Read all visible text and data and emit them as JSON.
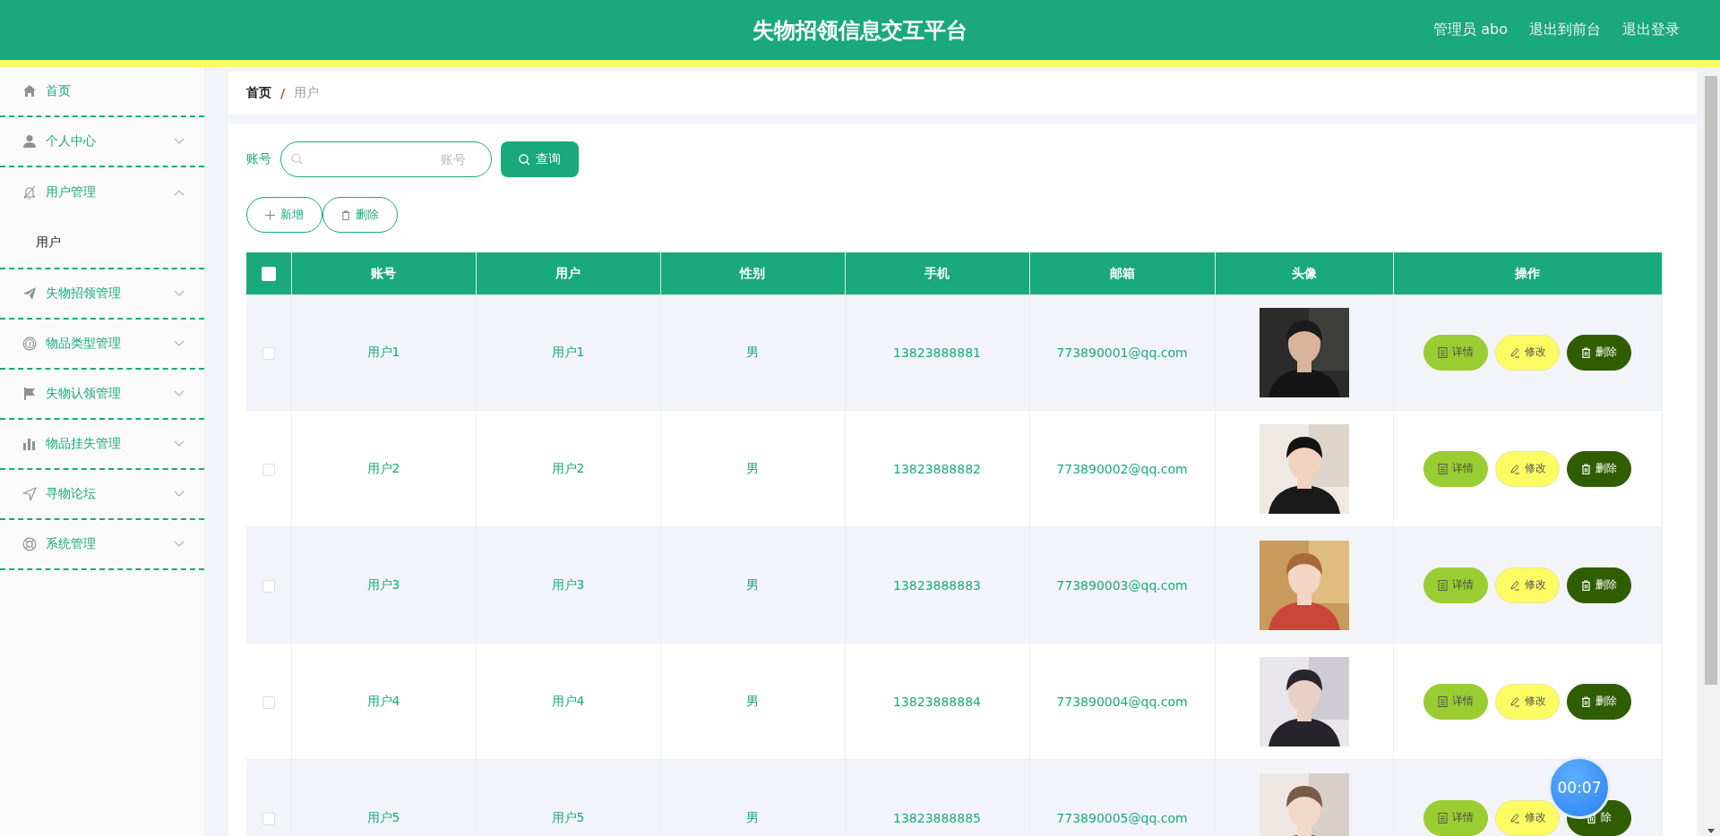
{
  "header": {
    "title": "失物招领信息交互平台",
    "links": [
      "管理员 abo",
      "退出到前台",
      "退出登录"
    ]
  },
  "sidebar": {
    "items": [
      {
        "label": "首页"
      },
      {
        "label": "个人中心",
        "expanded": false
      },
      {
        "label": "用户管理",
        "expanded": true,
        "children": [
          {
            "label": "用户"
          }
        ]
      },
      {
        "label": "失物招领管理",
        "expanded": false
      },
      {
        "label": "物品类型管理",
        "expanded": false
      },
      {
        "label": "失物认领管理",
        "expanded": false
      },
      {
        "label": "物品挂失管理",
        "expanded": false
      },
      {
        "label": "寻物论坛",
        "expanded": false
      },
      {
        "label": "系统管理",
        "expanded": false
      }
    ]
  },
  "breadcrumb": [
    "首页",
    "/",
    "用户"
  ],
  "search": {
    "label": "账号",
    "placeholder": "账号",
    "button": "查询"
  },
  "toolbar": [
    "新增",
    "删除"
  ],
  "table": {
    "all_checked": false,
    "columns": [
      "账号",
      "用户",
      "性别",
      "手机",
      "邮箱",
      "头像",
      "操作"
    ],
    "rows": [
      {
        "checked": false,
        "cells": [
          "用户1",
          "用户1",
          "男",
          "13823888881",
          "773890001@qq.com"
        ],
        "actions": [
          {
            "kind": "detail",
            "label": "详情"
          },
          {
            "kind": "edit",
            "label": "修改"
          },
          {
            "kind": "delete",
            "label": "删除"
          }
        ]
      },
      {
        "checked": false,
        "cells": [
          "用户2",
          "用户2",
          "男",
          "13823888882",
          "773890002@qq.com"
        ],
        "actions": [
          {
            "kind": "detail",
            "label": "详情"
          },
          {
            "kind": "edit",
            "label": "修改"
          },
          {
            "kind": "delete",
            "label": "删除"
          }
        ]
      },
      {
        "checked": false,
        "cells": [
          "用户3",
          "用户3",
          "男",
          "13823888883",
          "773890003@qq.com"
        ],
        "actions": [
          {
            "kind": "detail",
            "label": "详情"
          },
          {
            "kind": "edit",
            "label": "修改"
          },
          {
            "kind": "delete",
            "label": "删除"
          }
        ]
      },
      {
        "checked": false,
        "cells": [
          "用户4",
          "用户4",
          "男",
          "13823888884",
          "773890004@qq.com"
        ],
        "actions": [
          {
            "kind": "detail",
            "label": "详情"
          },
          {
            "kind": "edit",
            "label": "修改"
          },
          {
            "kind": "delete",
            "label": "删除"
          }
        ]
      },
      {
        "checked": false,
        "cells": [
          "用户5",
          "用户5",
          "男",
          "13823888885",
          "773890005@qq.com"
        ],
        "actions": [
          {
            "kind": "detail",
            "label": "详情"
          },
          {
            "kind": "edit",
            "label": "修改"
          },
          {
            "kind": "delete",
            "label": "除"
          }
        ]
      }
    ]
  },
  "timer": "00:07"
}
